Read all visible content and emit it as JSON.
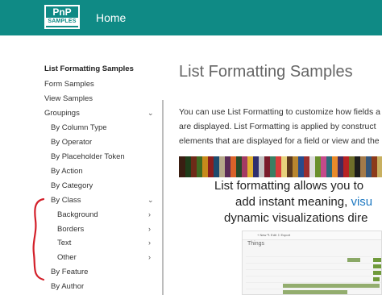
{
  "header": {
    "logo_line1": "PnP",
    "logo_line2": "SAMPLES",
    "home_label": "Home",
    "bg_color": "#0f8a85"
  },
  "sidebar": {
    "title": "List Formatting Samples",
    "items": [
      {
        "label": "Form Samples"
      },
      {
        "label": "View Samples"
      },
      {
        "label": "Groupings",
        "chevron": "chevron-down"
      },
      {
        "label": "By Column Type"
      },
      {
        "label": "By Operator"
      },
      {
        "label": "By Placeholder Token"
      },
      {
        "label": "By Action"
      },
      {
        "label": "By Category"
      },
      {
        "label": "By Class",
        "chevron": "chevron-down"
      },
      {
        "label": "Background",
        "chevron": "chevron-right"
      },
      {
        "label": "Borders",
        "chevron": "chevron-right"
      },
      {
        "label": "Text",
        "chevron": "chevron-right"
      },
      {
        "label": "Other",
        "chevron": "chevron-right"
      },
      {
        "label": "By Feature"
      },
      {
        "label": "By Author"
      }
    ]
  },
  "main": {
    "title": "List Formatting Samples",
    "para_lines": [
      "You can use List Formatting to customize how fields a",
      "are displayed. List Formatting is applied by construct",
      "elements that are displayed for a field or view and the"
    ],
    "banner_line1": "List formatting allows you to",
    "banner_line2a": "add instant meaning, ",
    "banner_line2b": "visu",
    "banner_line3": "dynamic visualizations dire",
    "screenshot_title": "Things",
    "screenshot_toolbar": "+ New  ✎ Edit  ⇩ Export",
    "accent_color": "#1d78c1"
  }
}
